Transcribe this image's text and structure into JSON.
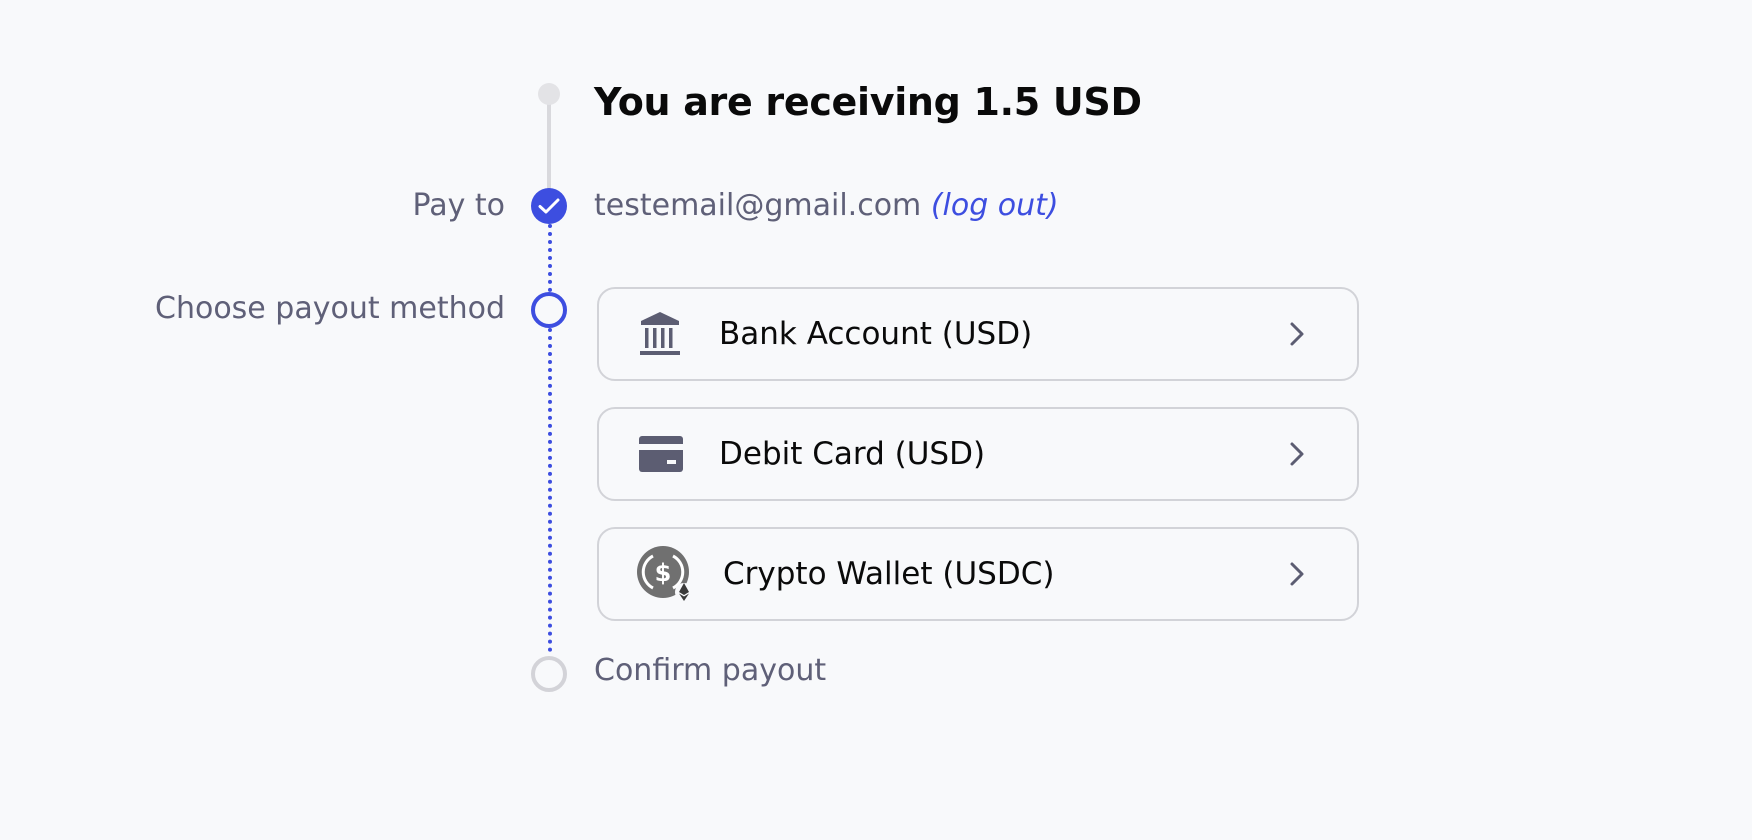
{
  "header": {
    "title": "You are receiving 1.5 USD"
  },
  "steps": {
    "pay_to": {
      "label": "Pay to",
      "email": "testemail@gmail.com",
      "logout_label": "(log out)"
    },
    "choose": {
      "label": "Choose payout method",
      "options": [
        {
          "label": "Bank Account (USD)",
          "icon": "bank-icon"
        },
        {
          "label": "Debit Card (USD)",
          "icon": "credit-card-icon"
        },
        {
          "label": "Crypto Wallet (USDC)",
          "icon": "usdc-coin-icon"
        }
      ]
    },
    "confirm": {
      "label": "Confirm payout"
    }
  },
  "colors": {
    "accent": "#3d4ee0",
    "muted_text": "#5f6078",
    "rail_gray": "#d9d9dd",
    "card_border": "#d2d3d8",
    "background": "#f8f9fb"
  }
}
